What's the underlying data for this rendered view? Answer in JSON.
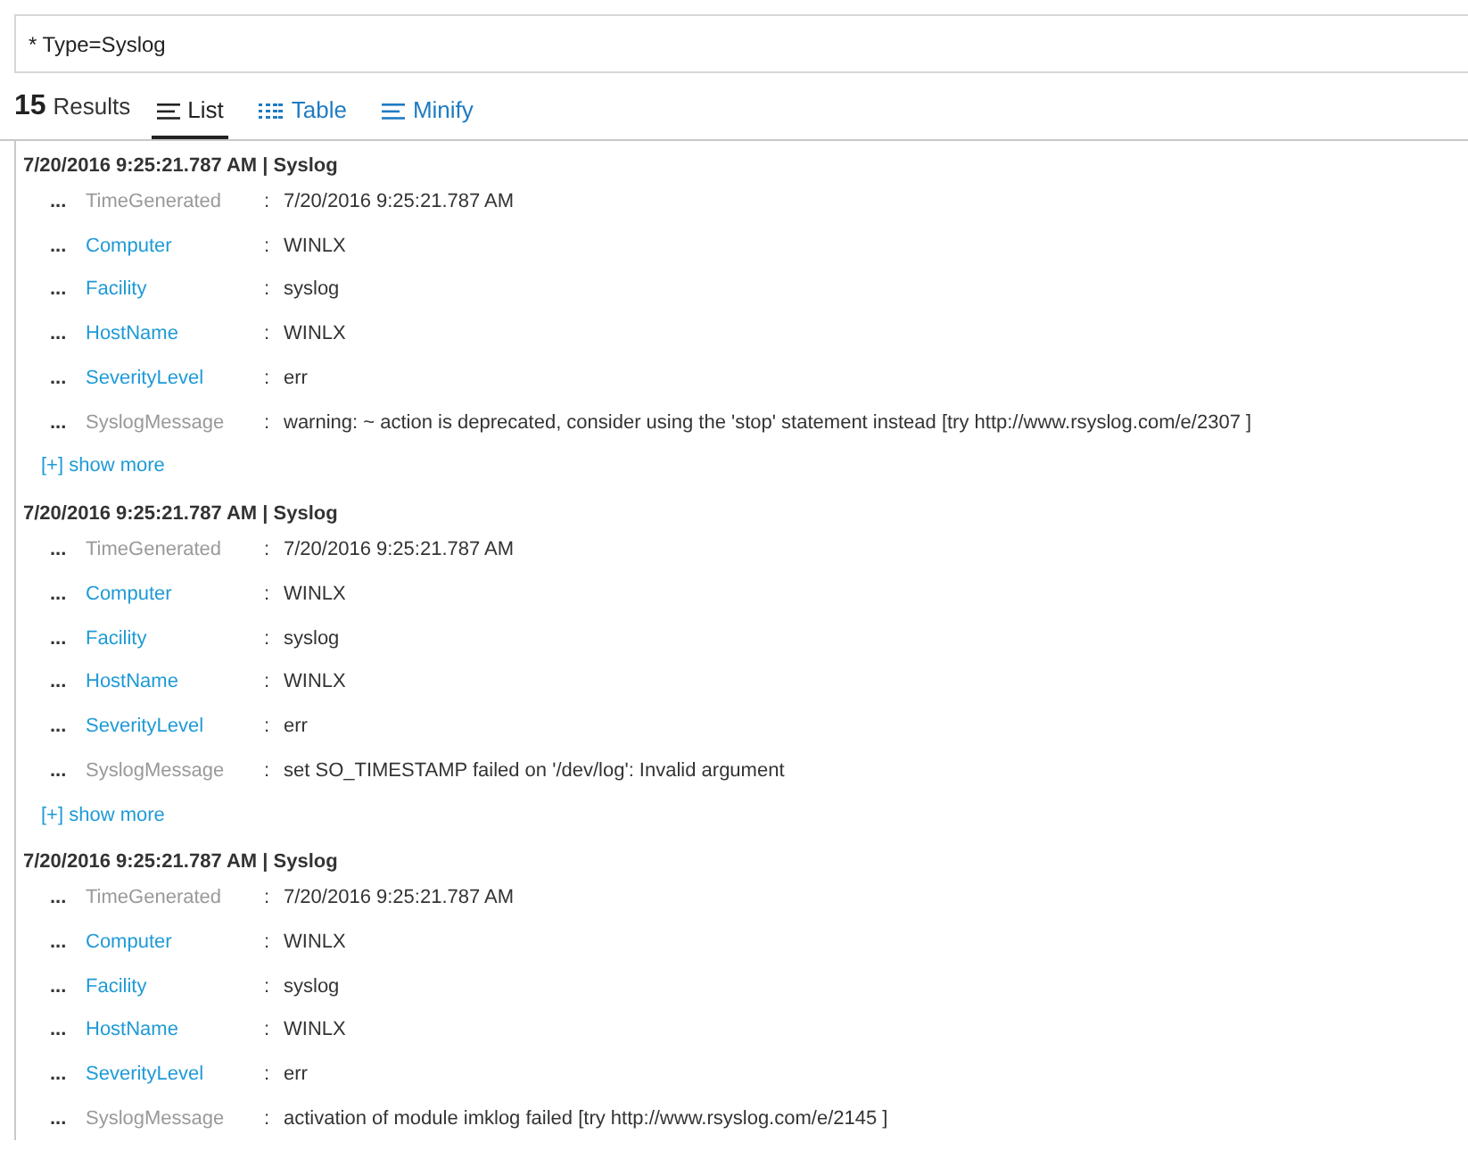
{
  "search": {
    "value": "* Type=Syslog"
  },
  "results": {
    "count": "15",
    "label": "Results"
  },
  "tabs": [
    {
      "label": "List",
      "kind": "list",
      "selected": true
    },
    {
      "label": "Table",
      "kind": "table",
      "selected": false
    },
    {
      "label": "Minify",
      "kind": "list",
      "selected": false
    }
  ],
  "entries": [
    {
      "header": "7/20/2016 9:25:21.787 AM | Syslog",
      "show_more": "[+] show more",
      "fields": [
        {
          "dots": "...",
          "name": "TimeGenerated",
          "link": false,
          "sep": ":",
          "value": "7/20/2016 9:25:21.787 AM"
        },
        {
          "dots": "...",
          "name": "Computer",
          "link": true,
          "sep": ":",
          "value": "WINLX"
        },
        {
          "dots": "...",
          "name": "Facility",
          "link": true,
          "sep": ":",
          "value": "syslog"
        },
        {
          "dots": "...",
          "name": "HostName",
          "link": true,
          "sep": ":",
          "value": "WINLX"
        },
        {
          "dots": "...",
          "name": "SeverityLevel",
          "link": true,
          "sep": ":",
          "value": "err"
        },
        {
          "dots": "...",
          "name": "SyslogMessage",
          "link": false,
          "sep": ":",
          "value": "warning: ~ action is deprecated, consider using the 'stop' statement instead [try http://www.rsyslog.com/e/2307 ]"
        }
      ]
    },
    {
      "header": "7/20/2016 9:25:21.787 AM | Syslog",
      "show_more": "[+] show more",
      "fields": [
        {
          "dots": "...",
          "name": "TimeGenerated",
          "link": false,
          "sep": ":",
          "value": "7/20/2016 9:25:21.787 AM"
        },
        {
          "dots": "...",
          "name": "Computer",
          "link": true,
          "sep": ":",
          "value": "WINLX"
        },
        {
          "dots": "...",
          "name": "Facility",
          "link": true,
          "sep": ":",
          "value": "syslog"
        },
        {
          "dots": "...",
          "name": "HostName",
          "link": true,
          "sep": ":",
          "value": "WINLX"
        },
        {
          "dots": "...",
          "name": "SeverityLevel",
          "link": true,
          "sep": ":",
          "value": "err"
        },
        {
          "dots": "...",
          "name": "SyslogMessage",
          "link": false,
          "sep": ":",
          "value": "set SO_TIMESTAMP failed on '/dev/log': Invalid argument"
        }
      ]
    },
    {
      "header": "7/20/2016 9:25:21.787 AM | Syslog",
      "fields": [
        {
          "dots": "...",
          "name": "TimeGenerated",
          "link": false,
          "sep": ":",
          "value": "7/20/2016 9:25:21.787 AM"
        },
        {
          "dots": "...",
          "name": "Computer",
          "link": true,
          "sep": ":",
          "value": "WINLX"
        },
        {
          "dots": "...",
          "name": "Facility",
          "link": true,
          "sep": ":",
          "value": "syslog"
        },
        {
          "dots": "...",
          "name": "HostName",
          "link": true,
          "sep": ":",
          "value": "WINLX"
        },
        {
          "dots": "...",
          "name": "SeverityLevel",
          "link": true,
          "sep": ":",
          "value": "err"
        },
        {
          "dots": "...",
          "name": "SyslogMessage",
          "link": false,
          "sep": ":",
          "value": "activation of module imklog failed [try http://www.rsyslog.com/e/2145 ]"
        }
      ]
    }
  ]
}
